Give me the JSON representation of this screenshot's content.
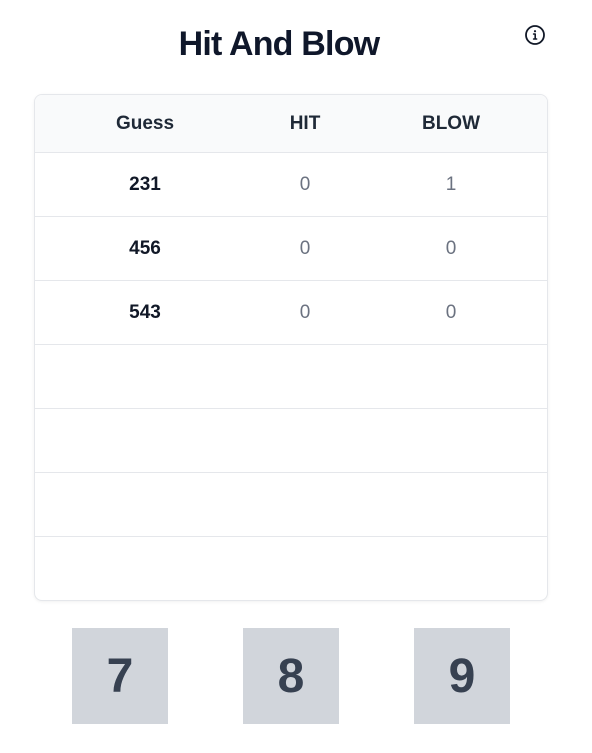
{
  "header": {
    "title": "Hit And Blow",
    "info_icon": "info-circle-icon"
  },
  "table": {
    "columns": [
      "Guess",
      "HIT",
      "BLOW"
    ],
    "rows": [
      {
        "guess": "231",
        "hit": "0",
        "blow": "1"
      },
      {
        "guess": "456",
        "hit": "0",
        "blow": "0"
      },
      {
        "guess": "543",
        "hit": "0",
        "blow": "0"
      },
      {
        "guess": "",
        "hit": "",
        "blow": ""
      },
      {
        "guess": "",
        "hit": "",
        "blow": ""
      },
      {
        "guess": "",
        "hit": "",
        "blow": ""
      },
      {
        "guess": "",
        "hit": "",
        "blow": ""
      }
    ]
  },
  "keypad": {
    "keys": [
      "7",
      "8",
      "9"
    ]
  },
  "colors": {
    "key_background": "#d1d5db",
    "key_text": "#374151",
    "header_background": "#f9fafb",
    "border": "#e5e7eb"
  }
}
